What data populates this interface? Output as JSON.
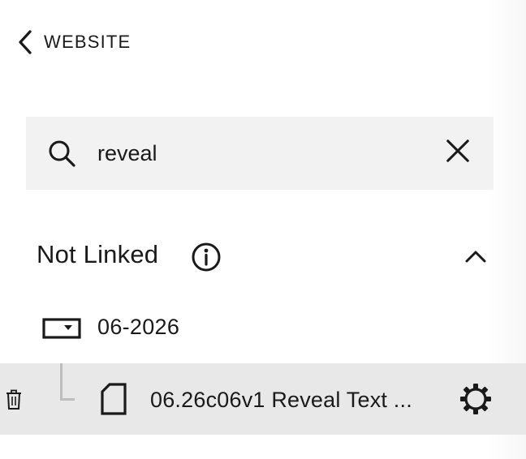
{
  "nav": {
    "back_label": "WEBSITE"
  },
  "search": {
    "value": "reveal"
  },
  "section": {
    "title": "Not Linked"
  },
  "folder": {
    "label": "06-2026"
  },
  "page_item": {
    "label": "06.26c06v1 Reveal Text ..."
  },
  "icons": {
    "back": "chevron-left-icon",
    "search": "search-icon",
    "clear": "close-icon",
    "info": "info-icon",
    "collapse": "chevron-up-icon",
    "folder": "folder-dropdown-icon",
    "trash": "trash-icon",
    "page": "page-icon",
    "settings": "gear-icon"
  },
  "colors": {
    "text": "#1a1a1a",
    "search_bg": "#f2f2f2",
    "selected_row_bg": "#e8e8e8",
    "connector": "#bdbdbd"
  }
}
